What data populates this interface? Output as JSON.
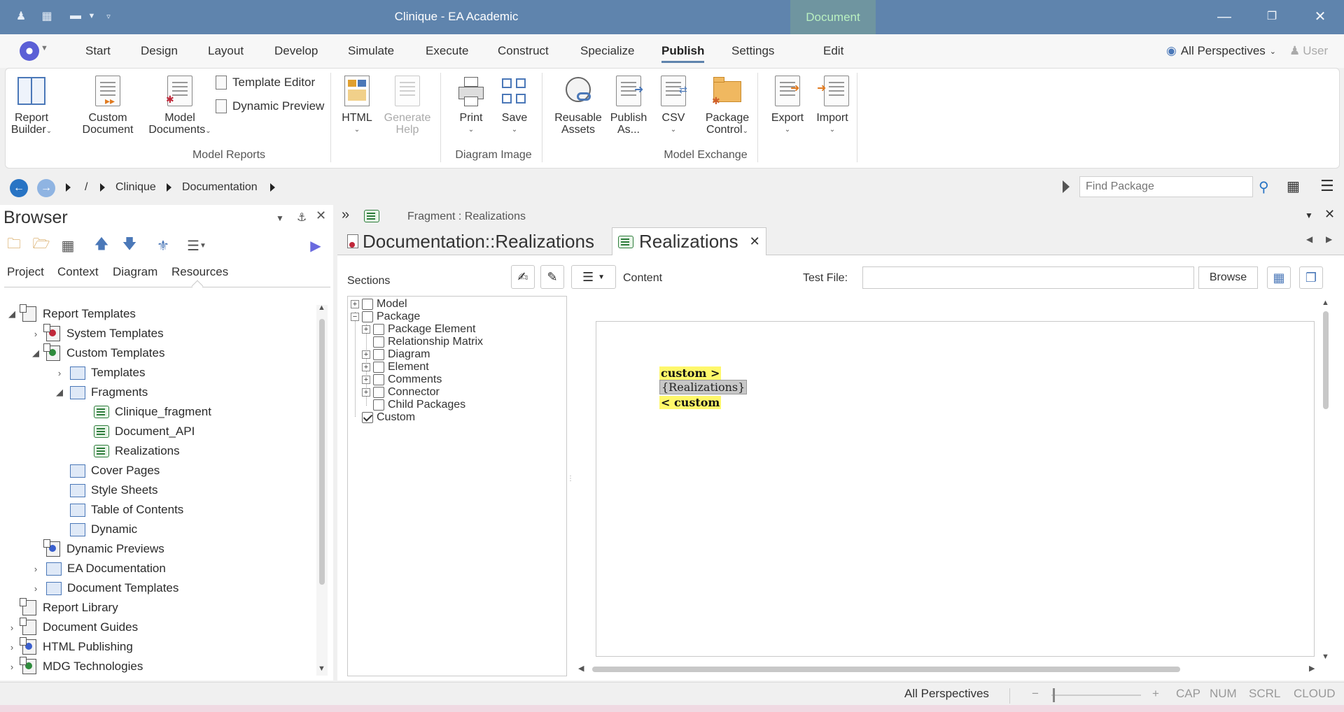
{
  "titlebar": {
    "app_title": "Clinique - EA Academic",
    "context_tab": "Document",
    "accent": "#5f84ad"
  },
  "menu": {
    "items": [
      "Start",
      "Design",
      "Layout",
      "Develop",
      "Simulate",
      "Execute",
      "Construct",
      "Specialize",
      "Publish",
      "Settings",
      "Edit"
    ],
    "active": "Publish",
    "perspectives": "All Perspectives",
    "user": "User"
  },
  "ribbon": {
    "report_builder": [
      "Report",
      "Builder"
    ],
    "custom_document": [
      "Custom",
      "Document"
    ],
    "model_documents": [
      "Model",
      "Documents"
    ],
    "template_editor": "Template Editor",
    "dynamic_preview": "Dynamic Preview",
    "html": "HTML",
    "generate_help": [
      "Generate",
      "Help"
    ],
    "print": "Print",
    "save": "Save",
    "reusable_assets": [
      "Reusable",
      "Assets"
    ],
    "publish_as": [
      "Publish",
      "As..."
    ],
    "csv": "CSV",
    "package_control": [
      "Package",
      "Control"
    ],
    "export": "Export",
    "import": "Import",
    "groups": {
      "model_reports": "Model Reports",
      "diagram_image": "Diagram Image",
      "model_exchange": "Model Exchange"
    }
  },
  "nav": {
    "root": "/",
    "crumbs": [
      "Clinique",
      "Documentation"
    ],
    "find_placeholder": "Find Package"
  },
  "browser": {
    "title": "Browser",
    "tabs": [
      "Project",
      "Context",
      "Diagram",
      "Resources"
    ],
    "active_tab": "Resources",
    "tree": {
      "report_templates": "Report Templates",
      "system_templates": "System Templates",
      "custom_templates": "Custom Templates",
      "templates": "Templates",
      "fragments": "Fragments",
      "clinique_fragment": "Clinique_fragment",
      "document_api": "Document_API",
      "realizations": "Realizations",
      "cover_pages": "Cover Pages",
      "style_sheets": "Style Sheets",
      "table_of_contents": "Table of Contents",
      "dynamic": "Dynamic",
      "dynamic_previews": "Dynamic Previews",
      "ea_documentation": "EA Documentation",
      "document_templates": "Document Templates",
      "report_library": "Report Library",
      "document_guides": "Document Guides",
      "html_publishing": "HTML Publishing",
      "mdg_technologies": "MDG Technologies"
    }
  },
  "editor": {
    "fragment_header": "Fragment : Realizations",
    "tab_doc": "Documentation::Realizations",
    "tab_realizations": "Realizations",
    "sections_label": "Sections",
    "content_label": "Content",
    "test_file_label": "Test File:",
    "test_file_value": "",
    "browse_label": "Browse",
    "sections": {
      "model": "Model",
      "package": "Package",
      "package_element": "Package Element",
      "relationship_matrix": "Relationship Matrix",
      "diagram": "Diagram",
      "element": "Element",
      "comments": "Comments",
      "connector": "Connector",
      "child_packages": "Child Packages",
      "custom": "Custom"
    },
    "content": {
      "line1": "custom >",
      "line2": "{Realizations}",
      "line3": "< custom"
    }
  },
  "status": {
    "perspectives": "All Perspectives",
    "minus": "−",
    "plus": "+",
    "cap": "CAP",
    "num": "NUM",
    "scrl": "SCRL",
    "cloud": "CLOUD"
  }
}
